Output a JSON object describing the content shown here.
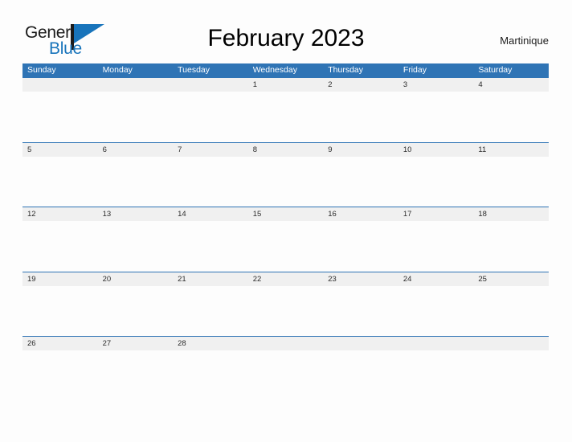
{
  "brand": {
    "name_part1": "General",
    "name_part2": "Blue",
    "flag_icon": "flag-icon",
    "accent_color": "#1874bb"
  },
  "header": {
    "title": "February 2023",
    "location": "Martinique"
  },
  "colors": {
    "header_bar": "#2f74b5",
    "row_band": "#f0f0f0",
    "row_divider": "#2f74b5",
    "page_background": "#fdfdfd",
    "text": "#2b2b2b"
  },
  "calendar": {
    "month": "February",
    "year": "2023",
    "weekday_headers": [
      "Sunday",
      "Monday",
      "Tuesday",
      "Wednesday",
      "Thursday",
      "Friday",
      "Saturday"
    ],
    "weeks": [
      [
        "",
        "",
        "",
        "1",
        "2",
        "3",
        "4"
      ],
      [
        "5",
        "6",
        "7",
        "8",
        "9",
        "10",
        "11"
      ],
      [
        "12",
        "13",
        "14",
        "15",
        "16",
        "17",
        "18"
      ],
      [
        "19",
        "20",
        "21",
        "22",
        "23",
        "24",
        "25"
      ],
      [
        "26",
        "27",
        "28",
        "",
        "",
        "",
        ""
      ]
    ]
  }
}
